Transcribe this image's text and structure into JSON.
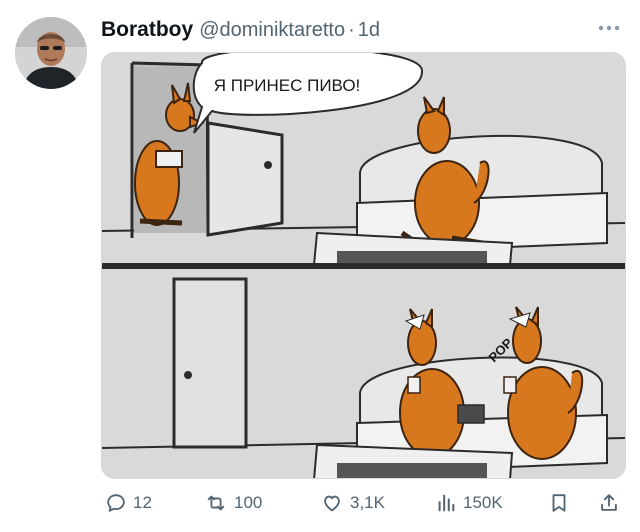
{
  "post": {
    "author": {
      "display_name": "Boratboy",
      "handle": "@dominiktaretto",
      "separator": "·",
      "time": "1d"
    },
    "more_icon": "more-horizontal-icon",
    "media": {
      "speech_bubble_text": "Я ПРИНЕС ПИВО!",
      "sound_effect_text": "POP"
    },
    "actions": {
      "replies": "12",
      "reposts": "100",
      "likes": "3,1K",
      "views": "150K"
    }
  }
}
